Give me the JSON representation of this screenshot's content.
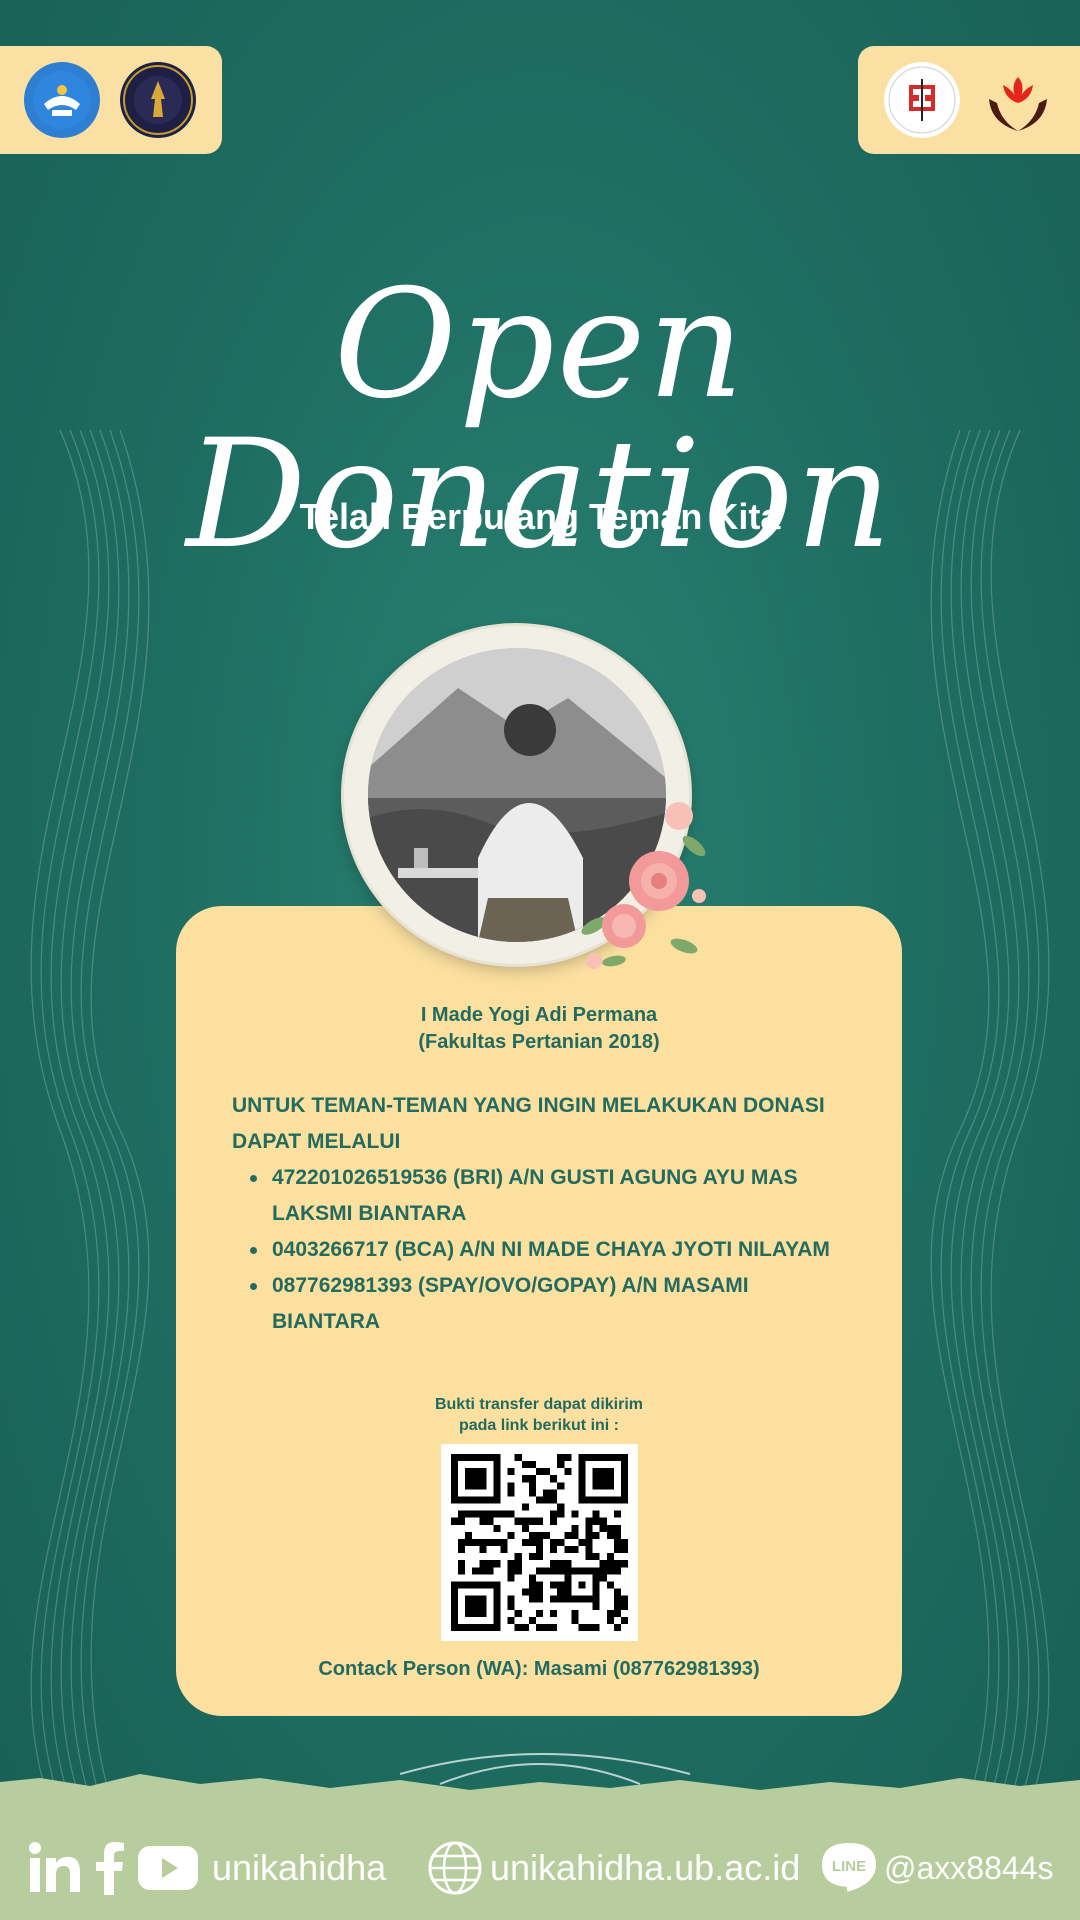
{
  "header": {
    "logos_left": [
      "kemdikbud-logo",
      "universitas-brawijaya-logo"
    ],
    "logos_right": [
      "unikahidha-logo",
      "lotus-hands-logo"
    ]
  },
  "hero": {
    "title": "Open Donation",
    "subtitle": "Telah Berpulang Teman Kita"
  },
  "card": {
    "name_line1": "I Made Yogi Adi Permana",
    "name_line2": "(Fakultas Pertanian 2018)",
    "intro": "UNTUK TEMAN-TEMAN YANG INGIN MELAKUKAN DONASI DAPAT MELALUI",
    "accounts": [
      "472201026519536 (BRI) A/N GUSTI AGUNG AYU MAS LAKSMI BIANTARA",
      "0403266717 (BCA) A/N NI MADE CHAYA JYOTI NILAYAM",
      "087762981393 (SPAY/OVO/GOPAY) A/N MASAMI BIANTARA"
    ],
    "proof_line1": "Bukti transfer dapat dikirim",
    "proof_line2": "pada link berikut ini :",
    "contact": "Contack Person (WA): Masami (087762981393)"
  },
  "footer": {
    "social_handle": "unikahidha",
    "website": "unikahidha.ub.ac.id",
    "line_id": "@axx8844s",
    "line_icon_label": "LINE",
    "icons": [
      "linkedin-icon",
      "facebook-icon",
      "youtube-icon",
      "globe-icon",
      "line-icon"
    ]
  },
  "colors": {
    "background": "#1f6f63",
    "card": "#fbe0a0",
    "text_dark": "#246b5f",
    "footer_band": "#b7cd9e"
  }
}
